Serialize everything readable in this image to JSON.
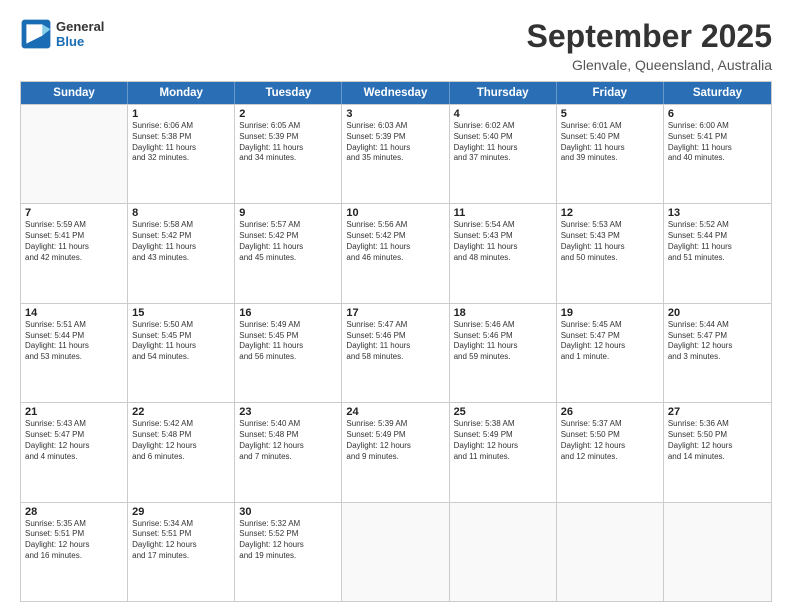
{
  "header": {
    "logo_line1": "General",
    "logo_line2": "Blue",
    "month": "September 2025",
    "location": "Glenvale, Queensland, Australia"
  },
  "weekdays": [
    "Sunday",
    "Monday",
    "Tuesday",
    "Wednesday",
    "Thursday",
    "Friday",
    "Saturday"
  ],
  "weeks": [
    [
      {
        "day": "",
        "info": ""
      },
      {
        "day": "1",
        "info": "Sunrise: 6:06 AM\nSunset: 5:38 PM\nDaylight: 11 hours\nand 32 minutes."
      },
      {
        "day": "2",
        "info": "Sunrise: 6:05 AM\nSunset: 5:39 PM\nDaylight: 11 hours\nand 34 minutes."
      },
      {
        "day": "3",
        "info": "Sunrise: 6:03 AM\nSunset: 5:39 PM\nDaylight: 11 hours\nand 35 minutes."
      },
      {
        "day": "4",
        "info": "Sunrise: 6:02 AM\nSunset: 5:40 PM\nDaylight: 11 hours\nand 37 minutes."
      },
      {
        "day": "5",
        "info": "Sunrise: 6:01 AM\nSunset: 5:40 PM\nDaylight: 11 hours\nand 39 minutes."
      },
      {
        "day": "6",
        "info": "Sunrise: 6:00 AM\nSunset: 5:41 PM\nDaylight: 11 hours\nand 40 minutes."
      }
    ],
    [
      {
        "day": "7",
        "info": "Sunrise: 5:59 AM\nSunset: 5:41 PM\nDaylight: 11 hours\nand 42 minutes."
      },
      {
        "day": "8",
        "info": "Sunrise: 5:58 AM\nSunset: 5:42 PM\nDaylight: 11 hours\nand 43 minutes."
      },
      {
        "day": "9",
        "info": "Sunrise: 5:57 AM\nSunset: 5:42 PM\nDaylight: 11 hours\nand 45 minutes."
      },
      {
        "day": "10",
        "info": "Sunrise: 5:56 AM\nSunset: 5:42 PM\nDaylight: 11 hours\nand 46 minutes."
      },
      {
        "day": "11",
        "info": "Sunrise: 5:54 AM\nSunset: 5:43 PM\nDaylight: 11 hours\nand 48 minutes."
      },
      {
        "day": "12",
        "info": "Sunrise: 5:53 AM\nSunset: 5:43 PM\nDaylight: 11 hours\nand 50 minutes."
      },
      {
        "day": "13",
        "info": "Sunrise: 5:52 AM\nSunset: 5:44 PM\nDaylight: 11 hours\nand 51 minutes."
      }
    ],
    [
      {
        "day": "14",
        "info": "Sunrise: 5:51 AM\nSunset: 5:44 PM\nDaylight: 11 hours\nand 53 minutes."
      },
      {
        "day": "15",
        "info": "Sunrise: 5:50 AM\nSunset: 5:45 PM\nDaylight: 11 hours\nand 54 minutes."
      },
      {
        "day": "16",
        "info": "Sunrise: 5:49 AM\nSunset: 5:45 PM\nDaylight: 11 hours\nand 56 minutes."
      },
      {
        "day": "17",
        "info": "Sunrise: 5:47 AM\nSunset: 5:46 PM\nDaylight: 11 hours\nand 58 minutes."
      },
      {
        "day": "18",
        "info": "Sunrise: 5:46 AM\nSunset: 5:46 PM\nDaylight: 11 hours\nand 59 minutes."
      },
      {
        "day": "19",
        "info": "Sunrise: 5:45 AM\nSunset: 5:47 PM\nDaylight: 12 hours\nand 1 minute."
      },
      {
        "day": "20",
        "info": "Sunrise: 5:44 AM\nSunset: 5:47 PM\nDaylight: 12 hours\nand 3 minutes."
      }
    ],
    [
      {
        "day": "21",
        "info": "Sunrise: 5:43 AM\nSunset: 5:47 PM\nDaylight: 12 hours\nand 4 minutes."
      },
      {
        "day": "22",
        "info": "Sunrise: 5:42 AM\nSunset: 5:48 PM\nDaylight: 12 hours\nand 6 minutes."
      },
      {
        "day": "23",
        "info": "Sunrise: 5:40 AM\nSunset: 5:48 PM\nDaylight: 12 hours\nand 7 minutes."
      },
      {
        "day": "24",
        "info": "Sunrise: 5:39 AM\nSunset: 5:49 PM\nDaylight: 12 hours\nand 9 minutes."
      },
      {
        "day": "25",
        "info": "Sunrise: 5:38 AM\nSunset: 5:49 PM\nDaylight: 12 hours\nand 11 minutes."
      },
      {
        "day": "26",
        "info": "Sunrise: 5:37 AM\nSunset: 5:50 PM\nDaylight: 12 hours\nand 12 minutes."
      },
      {
        "day": "27",
        "info": "Sunrise: 5:36 AM\nSunset: 5:50 PM\nDaylight: 12 hours\nand 14 minutes."
      }
    ],
    [
      {
        "day": "28",
        "info": "Sunrise: 5:35 AM\nSunset: 5:51 PM\nDaylight: 12 hours\nand 16 minutes."
      },
      {
        "day": "29",
        "info": "Sunrise: 5:34 AM\nSunset: 5:51 PM\nDaylight: 12 hours\nand 17 minutes."
      },
      {
        "day": "30",
        "info": "Sunrise: 5:32 AM\nSunset: 5:52 PM\nDaylight: 12 hours\nand 19 minutes."
      },
      {
        "day": "",
        "info": ""
      },
      {
        "day": "",
        "info": ""
      },
      {
        "day": "",
        "info": ""
      },
      {
        "day": "",
        "info": ""
      }
    ]
  ]
}
